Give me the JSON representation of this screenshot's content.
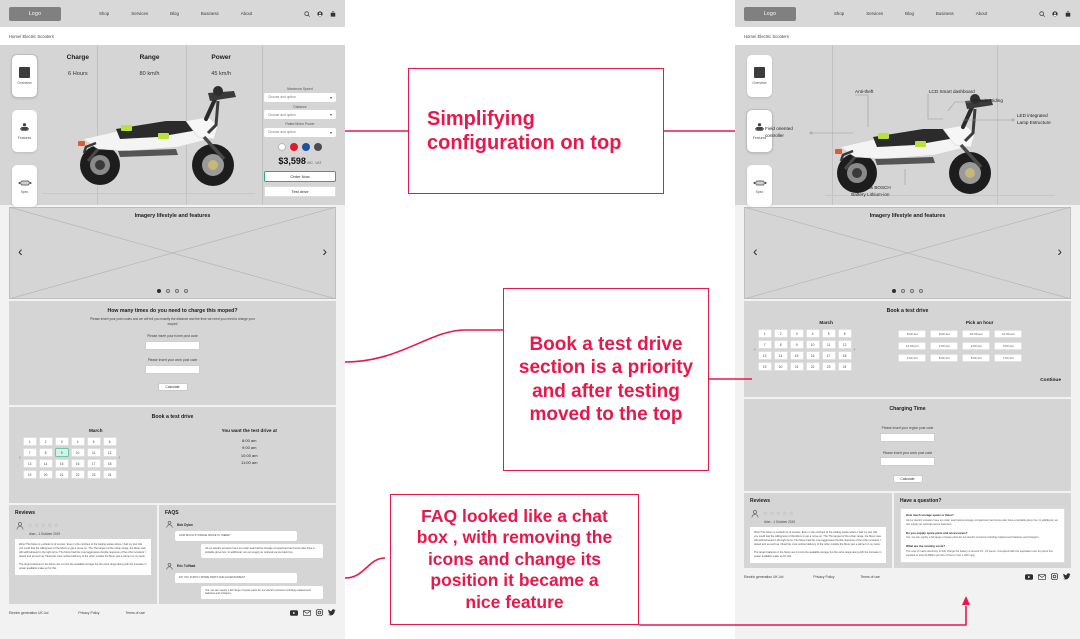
{
  "header": {
    "logo": "Logo",
    "nav": [
      "Shop",
      "Services",
      "Blog",
      "Business",
      "About"
    ],
    "icons": [
      "search-icon",
      "user-icon",
      "cart-icon"
    ],
    "breadcrumb": "Home/ Electric Scooters"
  },
  "sidetabs": [
    {
      "label": "Overview",
      "icon": "overview-icon"
    },
    {
      "label": "Features",
      "icon": "features-icon"
    },
    {
      "label": "Spec",
      "icon": "spec-icon"
    }
  ],
  "hero_left": {
    "specs": [
      {
        "key": "Charge",
        "value": "6 Hours"
      },
      {
        "key": "Range",
        "value": "80 km/h"
      },
      {
        "key": "Power",
        "value": "45 km/h"
      }
    ],
    "config": {
      "selects": [
        {
          "label": "Maximum Speed",
          "value": "Choose and option"
        },
        {
          "label": "Distance",
          "value": "Choose and option"
        },
        {
          "label": "Rated Motor Power",
          "value": "Choose and option"
        }
      ],
      "colors": [
        "#ffffff",
        "#e01b29",
        "#1d4fa3",
        "#4d4d4d"
      ],
      "price": "$3,598",
      "price_note": "INC. VAT",
      "order_button": "Order Now",
      "testdrive_button": "Test drive"
    }
  },
  "hero_right": {
    "callouts": [
      "Anti-theft",
      "LCD Smart dashboard",
      "3-Mode Riding",
      "LED integrated\nLamp Estructure",
      "Field oriented\ncontroller",
      "1500 Watts BOSCH\nBattery Lithium-ion"
    ]
  },
  "imagery": {
    "title": "Imagery lifestyle and features",
    "prev": "‹",
    "next": "›",
    "dots": 4,
    "active_dot": 0
  },
  "charging_left": {
    "title": "How many times do you need to charge this moped?",
    "subtitle": "Please insert your post codes and we will tell you exactly the distance and the time we need you need to charge your moped",
    "home_label": "Please insert your home post code",
    "work_label": "Please insert your work post code",
    "button": "Calculate"
  },
  "charging_right": {
    "title": "Charging Time",
    "region_label": "Please insert your region post code",
    "work_label": "Please insert your work post code",
    "button": "Calculate"
  },
  "testdrive_left": {
    "title": "Book a test drive",
    "month": "March",
    "days": [
      "1",
      "2",
      "3",
      "4",
      "5",
      "6",
      "7",
      "8",
      "9",
      "10",
      "11",
      "12",
      "13",
      "14",
      "15",
      "16",
      "17",
      "18",
      "19",
      "20",
      "21",
      "22",
      "23",
      "24"
    ],
    "selected_day": "9",
    "hours_title": "You want the test drive at",
    "hours": [
      "8:00 am",
      "9:00 am",
      "10:00 am",
      "11:00 am"
    ]
  },
  "testdrive_right": {
    "title": "Book a test drive",
    "month": "March",
    "days": [
      "1",
      "2",
      "3",
      "4",
      "5",
      "6",
      "7",
      "8",
      "9",
      "10",
      "11",
      "12",
      "13",
      "14",
      "15",
      "16",
      "17",
      "18",
      "19",
      "20",
      "21",
      "22",
      "23",
      "24"
    ],
    "hours_title": "Pick an hour",
    "hours": [
      "8:00 am",
      "9:00 am",
      "10:00 am",
      "11:00 am",
      "12:00 pm",
      "1:00 pm",
      "2:00 pm",
      "3:00 pm",
      "4:00 pm",
      "5:00 pm",
      "6:00 pm",
      "7:00 pm"
    ],
    "continue": "Continue"
  },
  "reviews": {
    "title": "Reviews",
    "reviewer": "Alan - 1 October 2019",
    "stars": 5,
    "body_1": "Wow! The Moov is a whole lot of scooter. Even in the confines of the trading estate where I had my test ride you could feel the willingness of the Moov to get a move on. The The largest of the urban range, the Moov was still well behaved in the tight turns. The Moov had the most aggressive throttle response of the other scooters I tested and as such as I liked the most noticed delivery of the other models the Moov just a winner on my tests.",
    "body_2": "The larger batteries in the Moov are not into the available storage but the extra range along with the increase in power available make up for this."
  },
  "faqs_left": {
    "title": "FAQS",
    "messages": [
      {
        "name": "Bob Dylan",
        "q": "HOW MUCH STORAGE SPACE IS THERE?",
        "a": "All our electric scooters have an under seat helmet storage compartment and some also have a lockable glove box. In additional, we can supply an optional secure back box."
      },
      {
        "name": "Eric Tuffbad",
        "q": "DO YOU SUPPLY SPARE PARTS AND ACCESSORIES?",
        "a": "Yes, we can supply a full range of spare parts for our electric scooters including replacement batteries and chargers."
      }
    ]
  },
  "faqs_right": {
    "title": "Have a question?",
    "items": [
      {
        "q": "How much storage space is there?",
        "a": "All our electric scooters have an under seat helmet storage compartment and some also have a lockable glove box. In additional, we can supply an optional secure back box."
      },
      {
        "q": "Do you supply spare parts and accessories?",
        "a": "Yes, we can supply a full range of spare parts for our electric scooters including replacement batteries and chargers."
      },
      {
        "q": "What are the running costs?",
        "a": "The cost of mains electricity to fully charge the battery is around 15 - 15 pence. Compared with the equivalent cost for petrol this equates to around 250km per litre of fuel or over 1,000 mpg."
      }
    ]
  },
  "footer": {
    "company": "Electric generation UK Ltd",
    "links": [
      "Privacy Policy",
      "Terms of use"
    ],
    "socials": [
      "youtube-icon",
      "mail-icon",
      "instagram-icon",
      "twitter-icon"
    ]
  },
  "annotations": [
    {
      "text": "Simplifying\nconfiguration on top"
    },
    {
      "text": "Book a test drive\nsection is a priority\nand after testing\nmoved to the top"
    },
    {
      "text": "FAQ looked like a chat\nbox , with removing the\nicons and change its\nposition it became a\nnice feature"
    }
  ],
  "accent": "#e8184c"
}
